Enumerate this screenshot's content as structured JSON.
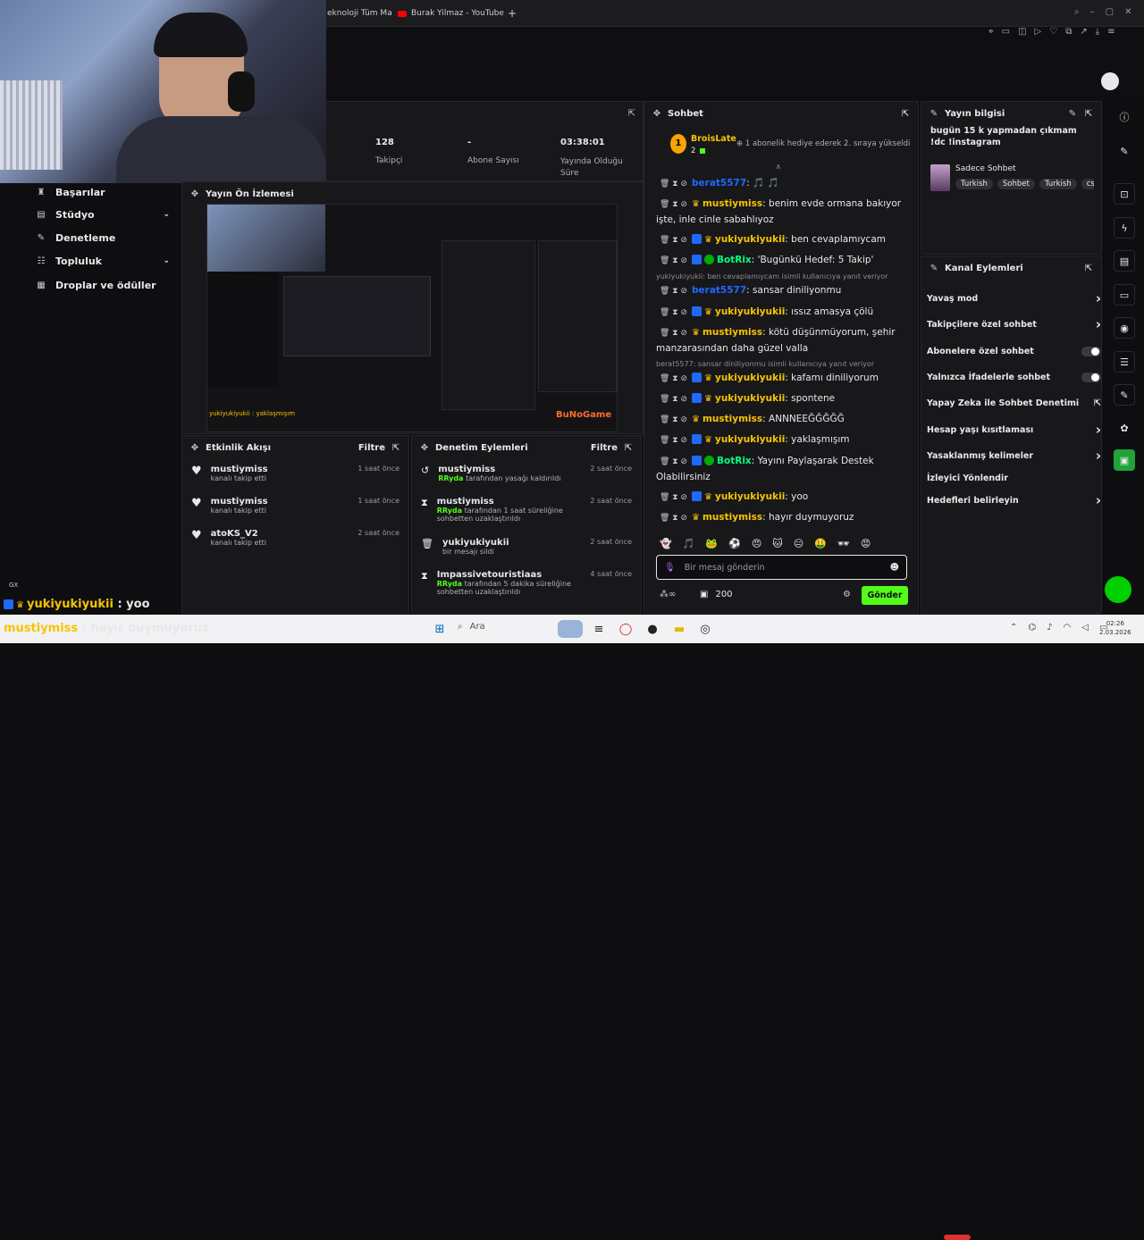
{
  "browser": {
    "tabs": [
      {
        "label": "eknoloji Tüm Ma"
      },
      {
        "label": "Burak Yilmaz - YouTube"
      }
    ],
    "new_tab": "+"
  },
  "stats": {
    "items": [
      {
        "value": "128",
        "label": "Takipçi"
      },
      {
        "value": "-",
        "label": "Abone Sayısı"
      },
      {
        "value": "03:38:01",
        "label": "Yayında Olduğu Süre"
      }
    ]
  },
  "sidebar": {
    "items": [
      {
        "label": "Başarılar",
        "icon": "trophy-icon"
      },
      {
        "label": "Stüdyo",
        "icon": "studio-icon",
        "chevron": true
      },
      {
        "label": "Denetleme",
        "icon": "wrench-icon"
      },
      {
        "label": "Topluluk",
        "icon": "community-icon",
        "chevron": true
      },
      {
        "label": "Droplar ve ödüller",
        "icon": "gift-icon"
      }
    ]
  },
  "preview": {
    "title": "Yayın Ön İzlemesi"
  },
  "activity": {
    "title": "Etkinlik Akışı",
    "filter": "Filtre",
    "items": [
      {
        "name": "mustiymiss",
        "sub": "kanalı takip etti",
        "time": "1 saat önce"
      },
      {
        "name": "mustiymiss",
        "sub": "kanalı takip etti",
        "time": "1 saat önce"
      },
      {
        "name": "atoKS_V2",
        "sub": "kanalı takip etti",
        "time": "2 saat önce"
      }
    ]
  },
  "modlog": {
    "title": "Denetim Eylemleri",
    "filter": "Filtre",
    "items": [
      {
        "name": "mustiymiss",
        "actor": "RRyda",
        "sub": " tarafından yasağı kaldırıldı",
        "time": "2 saat önce",
        "icon": "unban-icon"
      },
      {
        "name": "mustiymiss",
        "actor": "RRyda",
        "sub": " tarafından 1 saat süreliğine sohbetten uzaklaştırıldı",
        "time": "2 saat önce",
        "icon": "timeout-icon"
      },
      {
        "name": "yukiyukiyukii",
        "actor": "",
        "sub": "bir mesajı sildi",
        "time": "2 saat önce",
        "icon": "trash-icon"
      },
      {
        "name": "Impassivetouristiaas",
        "actor": "RRyda",
        "sub": " tarafından 5 dakika süreliğine sohbetten uzaklaştırıldı",
        "time": "4 saat önce",
        "icon": "timeout-icon"
      }
    ]
  },
  "chat": {
    "title": "Sohbet",
    "pinned": {
      "rank": "1",
      "name": "BroisLate",
      "count": "2",
      "text": "1 abonelik hediye ederek 2. sıraya yükseldi"
    },
    "messages": [
      {
        "user": "berat5577",
        "color": "#1f69ff",
        "text": ": 🎵 🎵",
        "badges": ""
      },
      {
        "user": "mustiymiss",
        "color": "#f6c400",
        "text": ": benim evde ormana bakıyor işte, inle cinle sabahlıyoz",
        "badges": "crown"
      },
      {
        "user": "yukiyukiyukii",
        "color": "#f6c400",
        "text": ": ben cevaplamıycam",
        "badges": "mod crown"
      },
      {
        "user": "BotRix",
        "color": "#00ff7f",
        "text": ": 'Bugünkü Hedef: 5 Takip'",
        "badges": "mod check"
      },
      {
        "user": "berat5577",
        "color": "#1f69ff",
        "text": ": sansar diniliyonmu",
        "badges": "",
        "reply": "yukiyukiyukii: ben cevaplamıycam isimli kullanıcıya yanıt veriyor"
      },
      {
        "user": "yukiyukiyukii",
        "color": "#f6c400",
        "text": ": ıssız amasya çölü",
        "badges": "mod crown"
      },
      {
        "user": "mustiymiss",
        "color": "#f6c400",
        "text": ": kötü düşünmüyorum, şehir manzarasından daha güzel valla",
        "badges": "crown"
      },
      {
        "user": "yukiyukiyukii",
        "color": "#f6c400",
        "text": ": kafamı diniliyorum",
        "badges": "mod crown",
        "reply": "berat5577: sansar diniliyonmu isimli kullanıcıya yanıt veriyor"
      },
      {
        "user": "yukiyukiyukii",
        "color": "#f6c400",
        "text": ": spontene",
        "badges": "mod crown"
      },
      {
        "user": "mustiymiss",
        "color": "#f6c400",
        "text": ": ANNNEEĞĞĞĞĞ",
        "badges": "crown"
      },
      {
        "user": "yukiyukiyukii",
        "color": "#f6c400",
        "text": ": yaklaşmışım",
        "badges": "mod crown"
      },
      {
        "user": "BotRix",
        "color": "#00ff7f",
        "text": ": Yayını Paylaşarak Destek Olabilirsiniz",
        "badges": "mod check"
      },
      {
        "user": "yukiyukiyukii",
        "color": "#f6c400",
        "text": ": yoo",
        "badges": "mod crown"
      },
      {
        "user": "mustiymiss",
        "color": "#f6c400",
        "text": ": hayır duymuyoruz",
        "badges": "crown"
      }
    ],
    "input_placeholder": "Bir mesaj gönderin",
    "points": "200",
    "send": "Gönder"
  },
  "stream_info": {
    "title": "Yayın bilgisi",
    "stream_title": "bugün 15 k yapmadan çıkmam !dc !instagram",
    "category": "Sadece Sohbet",
    "tags": [
      "Turkish",
      "Sohbet",
      "Turkish",
      "cs"
    ]
  },
  "channel_actions": {
    "title": "Kanal Eylemleri",
    "items": [
      {
        "label": "Yavaş mod",
        "control": "chevron"
      },
      {
        "label": "Takipçilere özel sohbet",
        "control": "chevron"
      },
      {
        "label": "Abonelere özel sohbet",
        "control": "toggle"
      },
      {
        "label": "Yalnızca İfadelerle sohbet",
        "control": "toggle"
      },
      {
        "label": "Yapay Zeka ile Sohbet Denetimi",
        "control": "external"
      },
      {
        "label": "Hesap yaşı kısıtlaması",
        "control": "chevron"
      },
      {
        "label": "Yasaklanmış kelimeler",
        "control": "chevron"
      },
      {
        "label": "İzleyici Yönlendir",
        "control": "none"
      },
      {
        "label": "Hedefleri belirleyin",
        "control": "chevron"
      }
    ]
  },
  "overlay": {
    "gx": "GX",
    "lines": [
      {
        "user": "yukiyukiyukii",
        "text": " : yoo",
        "color": "#f6c400"
      },
      {
        "user": "mustiymiss",
        "text": " : hayır duymuyoruz",
        "color": "#f6c400"
      }
    ]
  },
  "taskbar": {
    "search": "Ara",
    "time": "02:26",
    "date": "2.03.2026"
  },
  "colors": {
    "accent": "#53fc18",
    "bg": "#0e0e10",
    "panel": "#18181b"
  }
}
